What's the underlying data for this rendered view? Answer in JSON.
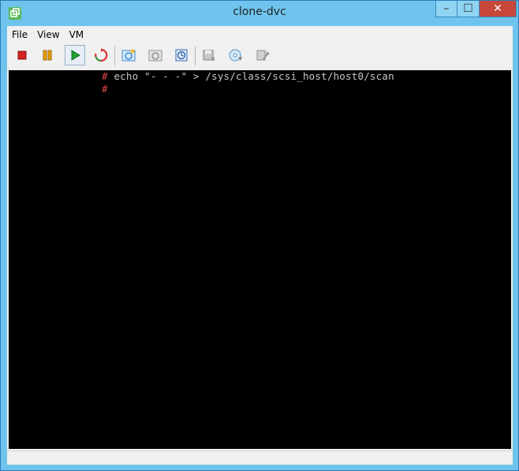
{
  "window": {
    "title": "clone-dvc",
    "app_icon": "vsphere-console-icon",
    "controls": {
      "minimize_glyph": "–",
      "maximize_glyph": "☐",
      "close_glyph": "✕"
    }
  },
  "menu": {
    "file_label": "File",
    "view_label": "View",
    "vm_label": "VM"
  },
  "toolbar": {
    "items": [
      {
        "name": "power-off-icon",
        "color": "#d42020"
      },
      {
        "name": "suspend-icon",
        "color": "#e8a000"
      },
      {
        "name": "power-on-icon",
        "color": "#20a030"
      },
      {
        "name": "reset-icon",
        "color": "#e03030"
      },
      {
        "name": "take-snapshot-icon",
        "color": "#3a8ad8"
      },
      {
        "name": "revert-snapshot-icon",
        "color": "#909090"
      },
      {
        "name": "snapshot-manager-icon",
        "color": "#3a6ab0"
      },
      {
        "name": "floppy-icon",
        "color": "#909090"
      },
      {
        "name": "cd-dvd-icon",
        "color": "#4a90c8"
      },
      {
        "name": "vm-settings-icon",
        "color": "#909090"
      }
    ]
  },
  "console": {
    "lines": [
      {
        "prompt": "#",
        "command": " echo \"- - -\" > /sys/class/scsi_host/host0/scan"
      },
      {
        "prompt": "#",
        "command": ""
      }
    ]
  }
}
